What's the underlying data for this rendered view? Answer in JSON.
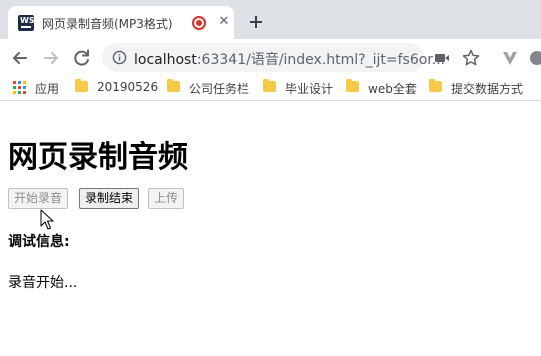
{
  "tab": {
    "favicon_text": "WS",
    "title": "网页录制音频(MP3格式)",
    "close_glyph": "✕"
  },
  "toolbar": {
    "url_host": "localhost",
    "url_rest": ":63341/语音/index.html?_ijt=fs6or..."
  },
  "bookmarks": [
    {
      "label": "应用",
      "icon": "apps-grid-icon"
    },
    {
      "label": "20190526",
      "icon": "folder-icon"
    },
    {
      "label": "公司任务栏",
      "icon": "folder-icon"
    },
    {
      "label": "毕业设计",
      "icon": "folder-icon"
    },
    {
      "label": "web全套",
      "icon": "folder-icon"
    },
    {
      "label": "提交数据方式",
      "icon": "folder-icon"
    }
  ],
  "page": {
    "heading": "网页录制音频",
    "buttons": {
      "start": "开始录音",
      "stop": "录制结束",
      "upload": "上传"
    },
    "debug_label": "调试信息:",
    "status": "录音开始..."
  },
  "colors": {
    "tabstrip_bg": "#dee1e6",
    "recording_red": "#d93025",
    "folder_yellow": "#f7c948"
  }
}
